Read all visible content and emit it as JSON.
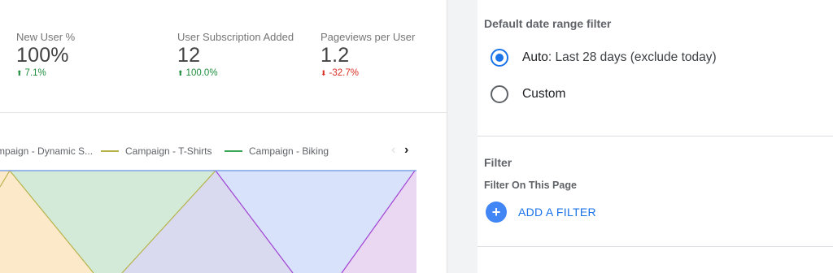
{
  "scorecards": [
    {
      "label": "New User %",
      "value": "100%",
      "delta": "7.1%",
      "direction": "up"
    },
    {
      "label": "User Subscription Added",
      "value": "12",
      "delta": "100.0%",
      "direction": "up"
    },
    {
      "label": "Pageviews per User",
      "value": "1.2",
      "delta": "-32.7%",
      "direction": "down"
    }
  ],
  "legend": {
    "items": [
      {
        "label": "mpaign - Dynamic S...",
        "color": "#f5d9a8"
      },
      {
        "label": "Campaign - T-Shirts",
        "color": "#b7b34a"
      },
      {
        "label": "Campaign - Biking",
        "color": "#3aa757"
      }
    ],
    "prev_icon": "chevron-left-icon",
    "next_icon": "chevron-right-icon",
    "prev_glyph": "‹",
    "next_glyph": "›"
  },
  "chart_colors": {
    "orange_fill": "#fbe9c9",
    "olive_line": "#b7b34a",
    "green_fill": "#d3ead8",
    "lavender_fill": "#d9d9ef",
    "blue_fill": "#d8e2fb",
    "purple_line": "#a142d4",
    "pink_fill": "#ead7f1",
    "top_line": "#7da1e6"
  },
  "date_range": {
    "title": "Default date range filter",
    "options": [
      {
        "label": "Auto",
        "suffix": ": Last 28 days (exclude today)",
        "checked": true
      },
      {
        "label": "Custom",
        "suffix": "",
        "checked": false
      }
    ]
  },
  "filter": {
    "title": "Filter",
    "subtitle": "Filter On This Page",
    "add_label": "ADD A FILTER",
    "add_icon": "plus-icon",
    "add_glyph": "+"
  }
}
